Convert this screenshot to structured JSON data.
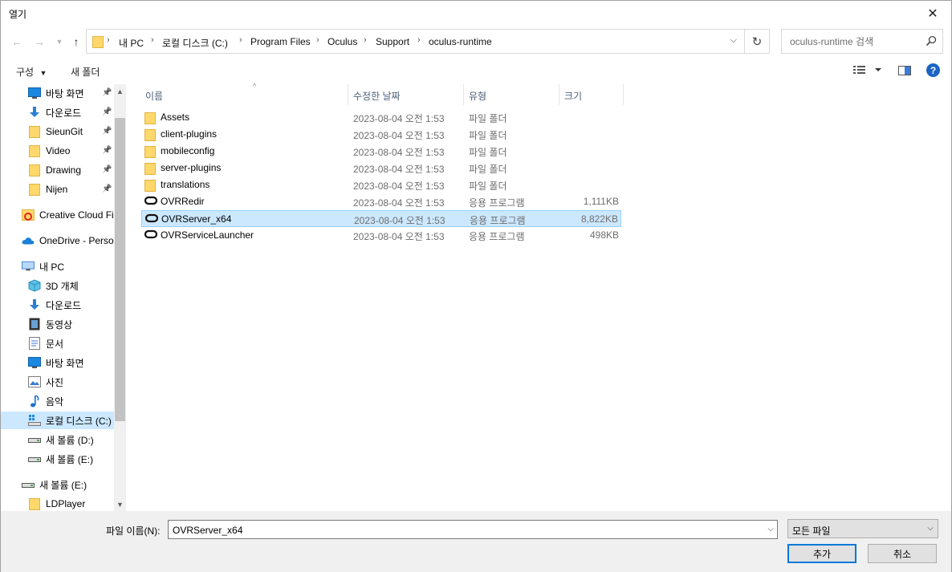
{
  "window": {
    "title": "열기"
  },
  "nav": {
    "breadcrumbs": [
      "내 PC",
      "로컬 디스크 (C:)",
      "Program Files",
      "Oculus",
      "Support",
      "oculus-runtime"
    ],
    "search_placeholder": "oculus-runtime 검색"
  },
  "toolbar": {
    "organize_label": "구성",
    "new_folder_label": "새 폴더"
  },
  "sidebar": {
    "items": [
      {
        "label": "바탕 화면",
        "icon": "desktop-icon",
        "pinned": true
      },
      {
        "label": "다운로드",
        "icon": "download-icon",
        "pinned": true
      },
      {
        "label": "SieunGit",
        "icon": "folder-icon",
        "pinned": true
      },
      {
        "label": "Video",
        "icon": "folder-icon",
        "pinned": true
      },
      {
        "label": "Drawing",
        "icon": "folder-icon",
        "pinned": true
      },
      {
        "label": "Nijen",
        "icon": "folder-icon",
        "pinned": true
      },
      {
        "label": "Creative Cloud Fil",
        "icon": "creative-cloud-icon"
      },
      {
        "label": "OneDrive - Person",
        "icon": "onedrive-icon"
      },
      {
        "label": "내 PC",
        "icon": "pc-icon"
      },
      {
        "label": "3D 개체",
        "icon": "3d-objects-icon"
      },
      {
        "label": "다운로드",
        "icon": "download-icon"
      },
      {
        "label": "동영상",
        "icon": "video-icon"
      },
      {
        "label": "문서",
        "icon": "document-icon"
      },
      {
        "label": "바탕 화면",
        "icon": "desktop-icon"
      },
      {
        "label": "사진",
        "icon": "pictures-icon"
      },
      {
        "label": "음악",
        "icon": "music-icon"
      },
      {
        "label": "로컬 디스크 (C:)",
        "icon": "drive-c-icon",
        "selected": true
      },
      {
        "label": "새 볼륨 (D:)",
        "icon": "drive-icon"
      },
      {
        "label": "새 볼륨 (E:)",
        "icon": "drive-icon"
      },
      {
        "label": "새 볼륨 (E:)",
        "icon": "drive-icon"
      },
      {
        "label": "LDPlayer",
        "icon": "folder-icon"
      }
    ]
  },
  "columns": {
    "name": "이름",
    "date": "수정한 날짜",
    "type": "유형",
    "size": "크기"
  },
  "files": [
    {
      "name": "Assets",
      "date": "2023-08-04 오전 1:53",
      "type": "파일 폴더",
      "size": "",
      "kind": "folder"
    },
    {
      "name": "client-plugins",
      "date": "2023-08-04 오전 1:53",
      "type": "파일 폴더",
      "size": "",
      "kind": "folder"
    },
    {
      "name": "mobileconfig",
      "date": "2023-08-04 오전 1:53",
      "type": "파일 폴더",
      "size": "",
      "kind": "folder"
    },
    {
      "name": "server-plugins",
      "date": "2023-08-04 오전 1:53",
      "type": "파일 폴더",
      "size": "",
      "kind": "folder"
    },
    {
      "name": "translations",
      "date": "2023-08-04 오전 1:53",
      "type": "파일 폴더",
      "size": "",
      "kind": "folder"
    },
    {
      "name": "OVRRedir",
      "date": "2023-08-04 오전 1:53",
      "type": "응용 프로그램",
      "size": "1,111KB",
      "kind": "app"
    },
    {
      "name": "OVRServer_x64",
      "date": "2023-08-04 오전 1:53",
      "type": "응용 프로그램",
      "size": "8,822KB",
      "kind": "app",
      "selected": true
    },
    {
      "name": "OVRServiceLauncher",
      "date": "2023-08-04 오전 1:53",
      "type": "응용 프로그램",
      "size": "498KB",
      "kind": "app"
    }
  ],
  "footer": {
    "filename_label": "파일 이름(N):",
    "filename_value": "OVRServer_x64",
    "filetype_value": "모든 파일",
    "open_label": "추가",
    "cancel_label": "취소"
  },
  "colors": {
    "selection": "#cce8ff",
    "selection_border": "#99d1ff",
    "folder": "#ffd86b",
    "accent": "#0078d7"
  }
}
